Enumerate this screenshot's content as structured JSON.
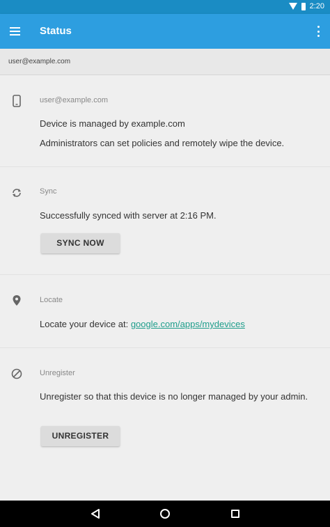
{
  "status_bar": {
    "time": "2:20"
  },
  "app_bar": {
    "title": "Status"
  },
  "account": {
    "email": "user@example.com"
  },
  "device": {
    "title": "user@example.com",
    "managed_text": "Device is managed by example.com",
    "admin_text": "Administrators can set policies and remotely wipe the device."
  },
  "sync": {
    "title": "Sync",
    "status_text": "Successfully synced with server at 2:16 PM.",
    "button_label": "SYNC NOW"
  },
  "locate": {
    "title": "Locate",
    "text_prefix": "Locate your device at: ",
    "link_text": "google.com/apps/mydevices"
  },
  "unregister": {
    "title": "Unregister",
    "text": "Unregister so that this device is no longer managed by your admin.",
    "button_label": "UNREGISTER"
  },
  "icons": {
    "menu": "menu-icon",
    "overflow": "more-vert-icon",
    "device": "phone-icon",
    "sync": "sync-icon",
    "locate": "location-pin-icon",
    "unregister": "block-icon"
  },
  "colors": {
    "status_bar": "#1a8cc4",
    "app_bar": "#2d9ee0",
    "link": "#1e9d8b",
    "background": "#efefef"
  }
}
